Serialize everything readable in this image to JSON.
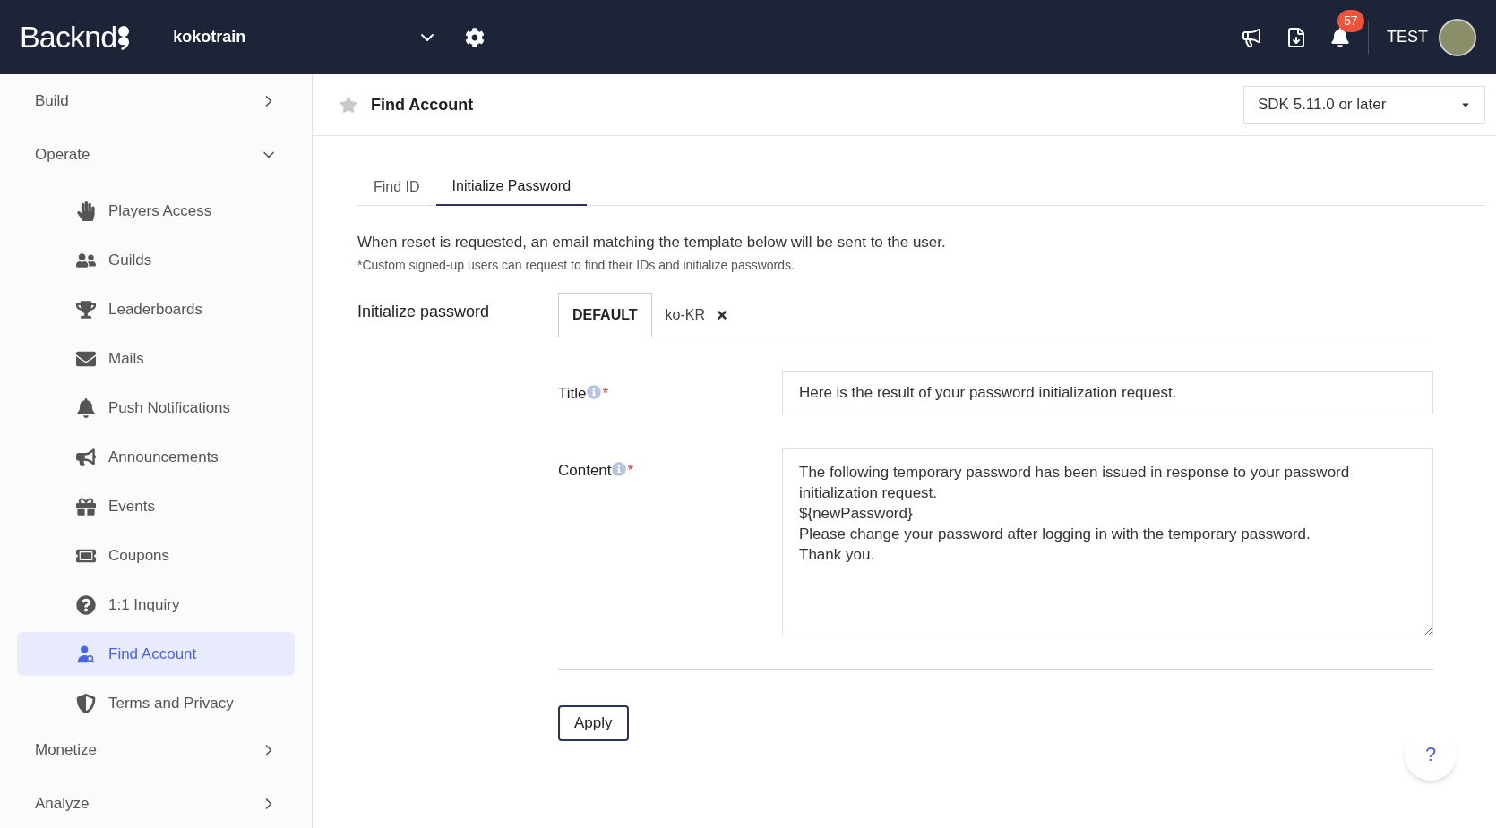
{
  "topbar": {
    "logo": "Backnd",
    "project": "kokotrain",
    "notification_count": "57",
    "user": "TEST"
  },
  "sidebar": {
    "sections": [
      {
        "label": "Build",
        "expanded": false
      },
      {
        "label": "Operate",
        "expanded": true,
        "items": [
          {
            "label": "Players Access",
            "selected": false
          },
          {
            "label": "Guilds",
            "selected": false
          },
          {
            "label": "Leaderboards",
            "selected": false
          },
          {
            "label": "Mails",
            "selected": false
          },
          {
            "label": "Push Notifications",
            "selected": false
          },
          {
            "label": "Announcements",
            "selected": false
          },
          {
            "label": "Events",
            "selected": false
          },
          {
            "label": "Coupons",
            "selected": false
          },
          {
            "label": "1:1 Inquiry",
            "selected": false
          },
          {
            "label": "Find Account",
            "selected": true
          },
          {
            "label": "Terms and Privacy",
            "selected": false
          }
        ]
      },
      {
        "label": "Monetize",
        "expanded": false
      },
      {
        "label": "Analyze",
        "expanded": false
      }
    ]
  },
  "page": {
    "title": "Find Account",
    "sdk_select": "SDK 5.11.0 or later",
    "tabs": [
      {
        "label": "Find ID",
        "selected": false
      },
      {
        "label": "Initialize Password",
        "selected": true
      }
    ],
    "description": "When reset is requested, an email matching the template below will be sent to the user.",
    "note": "*Custom signed-up users can request to find their IDs and initialize passwords.",
    "section_label": "Initialize password",
    "languages": [
      {
        "label": "DEFAULT",
        "selected": true,
        "removable": false
      },
      {
        "label": "ko-KR",
        "selected": false,
        "removable": true
      }
    ],
    "fields": [
      {
        "kind": "input",
        "label": "Title",
        "required_mark": "*",
        "value": "Here is the result of your password initialization request."
      },
      {
        "kind": "textarea",
        "label": "Content",
        "required_mark": "*",
        "value": "The following temporary password has been issued in response to your password initialization request.\n${newPassword}\nPlease change your password after logging in with the temporary password.\nThank you."
      }
    ],
    "apply_button": "Apply",
    "help_button": "?"
  }
}
